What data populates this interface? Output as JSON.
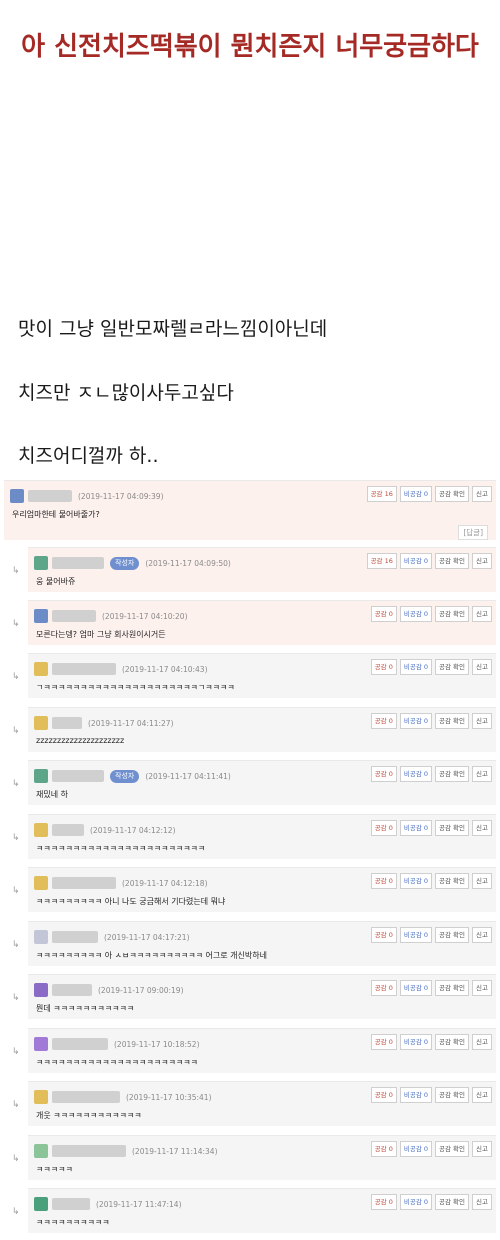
{
  "title": "아 신전치즈떡볶이 뭔치즌지 너무궁금하다",
  "body_lines": [
    "맛이 그냥 일반모짜렐ㄹ라느낌이아닌데",
    "치즈만 ㅈㄴ많이사두고싶다",
    "치즈어디껄까 하.."
  ],
  "buttons": {
    "report": "신고",
    "like_check": "공감 확인"
  },
  "writer_badge": "작성자",
  "reply_label": "[답글]",
  "reply_arrow": "↳",
  "comments": [
    {
      "ts": "(2019-11-17 04:09:39)",
      "like": "공감 16",
      "dislike": "비공감 0",
      "text": "우리엄마한테 물어바줄가?",
      "avatar": "#6b8cc7",
      "name_w": 44
    },
    {
      "ts": "(2019-11-17 04:09:50)",
      "like": "공감 16",
      "dislike": "비공감 0",
      "text": "웅 물어바쥬",
      "avatar": "#5da68a",
      "name_w": 52
    },
    {
      "ts": "(2019-11-17 04:10:20)",
      "like": "공감 0",
      "dislike": "비공감 0",
      "text": "모른다는뎅? 엄마 그냥 회사원이시거든",
      "avatar": "#6b8cc7",
      "name_w": 44
    },
    {
      "ts": "(2019-11-17 04:10:43)",
      "like": "공감 0",
      "dislike": "비공감 0",
      "text": "ㄱㅋㅋㅋㅋㅋㅋㅋㅋㅋㅋㅋㅋㅋㅋㅋㅋㅋㅋㅋㅋㅋㄱㅋㅋㅋㅋ",
      "avatar": "#e2be5a",
      "name_w": 64
    },
    {
      "ts": "(2019-11-17 04:11:27)",
      "like": "공감 0",
      "dislike": "비공감 0",
      "text": "zzzzzzzzzzzzzzzzzzzzz",
      "avatar": "#e2be5a",
      "name_w": 30
    },
    {
      "ts": "(2019-11-17 04:11:41)",
      "like": "공감 0",
      "dislike": "비공감 0",
      "text": "재밌네 하",
      "avatar": "#5da68a",
      "name_w": 52
    },
    {
      "ts": "(2019-11-17 04:12:12)",
      "like": "공감 0",
      "dislike": "비공감 0",
      "text": "ㅋㅋㅋㅋㅋㅋㅋㅋㅋㅋㅋㅋㅋㅋㅋㅋㅋㅋㅋㅋㅋㅋㅋ",
      "avatar": "#e2be5a",
      "name_w": 32
    },
    {
      "ts": "(2019-11-17 04:12:18)",
      "like": "공감 0",
      "dislike": "비공감 0",
      "text": "ㅋㅋㅋㅋㅋㅋㅋㅋㅋ 아니 나도 궁금해서 기다렸는데 뭐냐",
      "avatar": "#e2be5a",
      "name_w": 64
    },
    {
      "ts": "(2019-11-17 04:17:21)",
      "like": "공감 0",
      "dislike": "비공감 0",
      "text": "ㅋㅋㅋㅋㅋㅋㅋㅋㅋ 아 ㅅㅂㅋㅋㅋㅋㅋㅋㅋㅋㅋㅋ 어그로 개신박하네",
      "avatar": "#c3c6d6",
      "name_w": 46
    },
    {
      "ts": "(2019-11-17 09:00:19)",
      "like": "공감 0",
      "dislike": "비공감 0",
      "text": "뭔데 ㅋㅋㅋㅋㅋㅋㅋㅋㅋㅋㅋ",
      "avatar": "#8a6cc7",
      "name_w": 40
    },
    {
      "ts": "(2019-11-17 10:18:52)",
      "like": "공감 0",
      "dislike": "비공감 0",
      "text": "ㅋㅋㅋㅋㅋㅋㅋㅋㅋㅋㅋㅋㅋㅋㅋㅋㅋㅋㅋㅋㅋㅋ",
      "avatar": "#a07ad6",
      "name_w": 56
    },
    {
      "ts": "(2019-11-17 10:35:41)",
      "like": "공감 0",
      "dislike": "비공감 0",
      "text": "개웃 ㅋㅋㅋㅋㅋㅋㅋㅋㅋㅋㅋㅋ",
      "avatar": "#e2be5a",
      "name_w": 68
    },
    {
      "ts": "(2019-11-17 11:14:34)",
      "like": "공감 0",
      "dislike": "비공감 0",
      "text": "ㅋㅋㅋㅋㅋ",
      "avatar": "#8cc49a",
      "name_w": 74
    },
    {
      "ts": "(2019-11-17 11:47:14)",
      "like": "공감 0",
      "dislike": "비공감 0",
      "text": "ㅋㅋㅋㅋㅋㅋㅋㅋㅋㅋ",
      "avatar": "#4aa07a",
      "name_w": 38
    }
  ]
}
